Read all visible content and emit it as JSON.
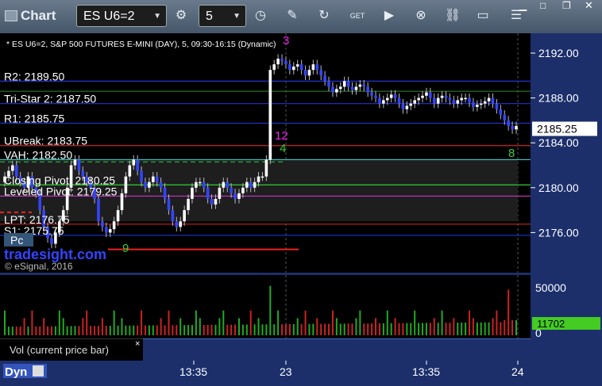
{
  "toolbar": {
    "title": "Chart",
    "symbol": "ES U6=2",
    "interval": "5",
    "icons": [
      "settings-icon",
      "clock-icon",
      "pencil-icon",
      "refresh-icon",
      "get-icon",
      "play-icon",
      "close-circle-icon",
      "link-icon",
      "comment-icon",
      "menu-icon"
    ]
  },
  "chart": {
    "header": "* ES U6=2, S&P 500 FUTURES E-MINI (DAY), 5, 09:30-16:15 (Dynamic)",
    "copyright": "© eSignal, 2016",
    "brand": "tradesight.com",
    "pc_badge": "Pc",
    "price_ticks": [
      "2192.00",
      "2188.00",
      "2184.00",
      "2180.00",
      "2176.00"
    ],
    "current_price": "2185.25",
    "levels": [
      {
        "label": "R2: 2189.50",
        "color": "#2233cc"
      },
      {
        "label": "Tri-Star 2: 2187.50",
        "color": "#2233cc"
      },
      {
        "label": "R1: 2185.75",
        "color": "#2233cc"
      },
      {
        "label": "UBreak: 2183.75",
        "color": "#cc2222"
      },
      {
        "label": "VAH: 2182.50",
        "color": "#33cccc"
      },
      {
        "label": "Closing Pivot: 2180.25",
        "color": "#33cc33"
      },
      {
        "label": "Leveled Pivot: 2179.25",
        "color": "#cc33cc"
      },
      {
        "label": "LPT: 2176.75",
        "color": "#cc2222"
      },
      {
        "label": "S1: 2175.75",
        "color": "#2233cc"
      }
    ],
    "markers": [
      "3",
      "12",
      "4",
      "9",
      "8"
    ]
  },
  "volume": {
    "ticks": [
      "50000",
      "0"
    ],
    "current": "11702",
    "legend": "Vol (current price bar)",
    "close": "×"
  },
  "time_axis": {
    "labels": [
      "13:35",
      "23",
      "13:35",
      "24"
    ],
    "dyn": "Dyn"
  },
  "colors": {
    "up": "#ffffff",
    "down": "#3344ff",
    "vol_up": "#22aa22",
    "vol_down": "#cc2222",
    "accent": "#33cc33"
  }
}
